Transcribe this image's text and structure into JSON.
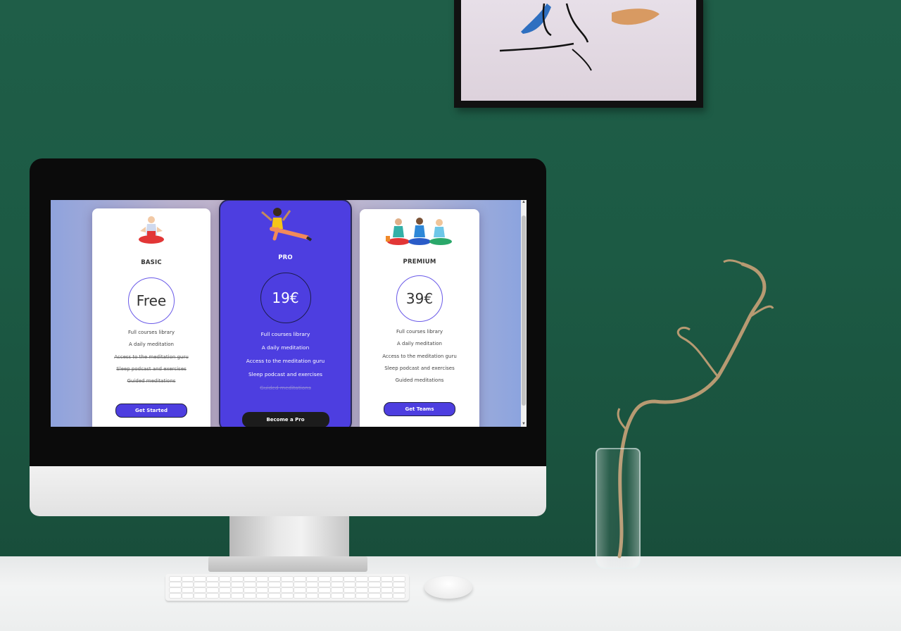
{
  "pricing": {
    "plans": [
      {
        "name": "BASIC",
        "price": "Free",
        "features": [
          {
            "text": "Full courses library",
            "included": true
          },
          {
            "text": "A daily meditation",
            "included": true
          },
          {
            "text": "Access to the meditation guru",
            "included": false
          },
          {
            "text": "Sleep podcast and exercises",
            "included": false
          },
          {
            "text": "Guided meditations",
            "included": false
          }
        ],
        "cta": "Get Started"
      },
      {
        "name": "PRO",
        "price": "19€",
        "features": [
          {
            "text": "Full courses library",
            "included": true
          },
          {
            "text": "A daily meditation",
            "included": true
          },
          {
            "text": "Access to the meditation guru",
            "included": true
          },
          {
            "text": "Sleep podcast and exercises",
            "included": true
          },
          {
            "text": "Guided meditations",
            "included": false
          }
        ],
        "cta": "Become a Pro"
      },
      {
        "name": "PREMIUM",
        "price": "39€",
        "features": [
          {
            "text": "Full courses library",
            "included": true
          },
          {
            "text": "A daily meditation",
            "included": true
          },
          {
            "text": "Access to the meditation guru",
            "included": true
          },
          {
            "text": "Sleep podcast and exercises",
            "included": true
          },
          {
            "text": "Guided meditations",
            "included": true
          }
        ],
        "cta": "Get Teams"
      }
    ]
  },
  "colors": {
    "accent": "#4d3ee0",
    "dark_button": "#1c1c1c",
    "wall": "#1c5a44"
  },
  "icons": {
    "basic": "meditating-person-illustration",
    "pro": "floating-yoga-person-illustration",
    "premium": "group-meditation-illustration"
  }
}
